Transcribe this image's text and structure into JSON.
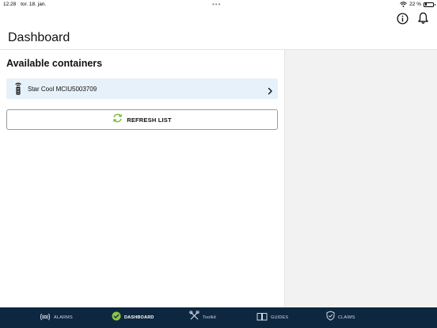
{
  "status_bar": {
    "time": "12.28",
    "date": "tor. 18. jan.",
    "dots": "•••",
    "battery_text": "22 %",
    "battery_level": 0.22
  },
  "header": {
    "title": "Dashboard",
    "info_icon": "info-icon",
    "bell_icon": "bell-icon"
  },
  "main": {
    "section_title": "Available containers",
    "containers": [
      {
        "label": "Star Cool MCIU5003709",
        "icon": "container-signal-icon"
      }
    ],
    "refresh_label": "REFRESH LIST"
  },
  "tabbar": {
    "tabs": [
      {
        "label": "ALARMS",
        "icon": "alarm-signal-icon",
        "active": false
      },
      {
        "label": "DASHBOARD",
        "icon": "dashboard-check-icon",
        "active": true
      },
      {
        "label": "Toolkit",
        "icon": "tools-icon",
        "active": false
      },
      {
        "label": "GUIDES",
        "icon": "book-icon",
        "active": false
      },
      {
        "label": "CLAIMS",
        "icon": "shield-check-icon",
        "active": false
      }
    ]
  },
  "colors": {
    "tabbar_bg": "#0e2740",
    "accent_green": "#8cc63f",
    "item_bg": "#e6f1f9",
    "panel_bg": "#f2f2f2"
  }
}
